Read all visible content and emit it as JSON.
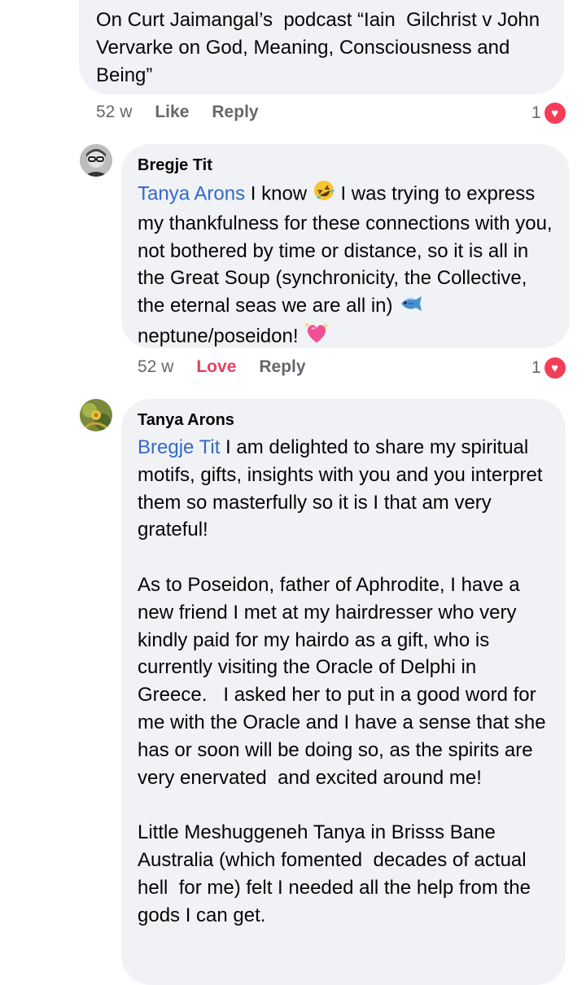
{
  "comments": [
    {
      "text": "On Curt Jaimangal’s  podcast “Iain  Gilchrist v John Vervarke on God, Meaning, Consciousness and Being”",
      "time": "52 w",
      "action1": "Like",
      "reply": "Reply",
      "reaction_count": "1"
    },
    {
      "author": "Bregje Tit",
      "mention": "Tanya Arons",
      "text_a": " I know ",
      "text_b": " I was trying to express my thankfulness for these connections with you, not bothered by time or distance, so it is all in the Great Soup (synchronicity, the Collective, the eternal seas we are all in) ",
      "text_c": " neptune/poseidon! ",
      "time": "52 w",
      "action1": "Love",
      "reply": "Reply",
      "reaction_count": "1"
    },
    {
      "author": "Tanya Arons",
      "mention": "Bregje Tit",
      "para1": " I am delighted to share my spiritual motifs, gifts, insights with you and you interpret them so masterfully so it is I that am very grateful!",
      "para2": "As to Poseidon, father of Aphrodite, I have a new friend I met at my hairdresser who very kindly paid for my hairdo as a gift, who is currently visiting the Oracle of Delphi in Greece.   I asked her to put in a good word for me with the Oracle and I have a sense that she has or soon will be doing so, as the spirits are very enervated  and excited around me!",
      "para3": "Little Meshuggeneh Tanya in Brisss Bane Australia (which fomented  decades of actual hell  for me) felt I needed all the help from the gods I can get."
    }
  ],
  "colors": {
    "bubble": "#f0f2f5",
    "mention": "#3469c7",
    "love": "#e4405f",
    "heart": "#f33e58",
    "meta": "#65676b"
  },
  "icons": [
    "rofl-emoji",
    "fish-emoji",
    "sparkling-heart-emoji",
    "heart-reaction-icon"
  ]
}
